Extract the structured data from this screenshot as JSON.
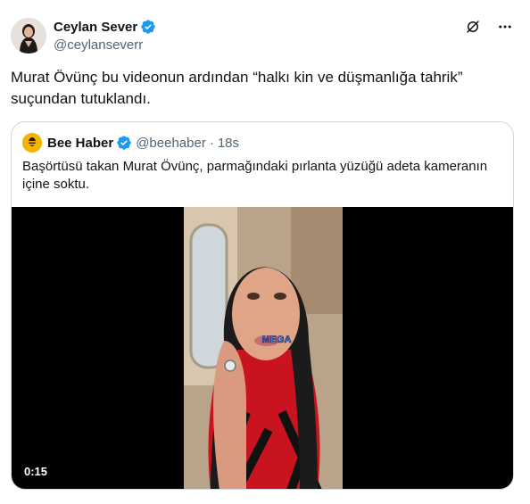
{
  "author": {
    "name": "Ceylan Sever",
    "handle": "@ceylanseverr",
    "avatar_icon": "user-avatar",
    "verified_color": "#1d9bf0"
  },
  "tweet": {
    "text": "Murat Övünç bu videonun ardından “halkı kin ve düşmanlığa tahrik” suçundan tutuklandı."
  },
  "icons": {
    "grok": "grok-icon",
    "more": "more-icon"
  },
  "quote": {
    "name": "Bee Haber",
    "handle": "@beehaber",
    "separator": "·",
    "time": "18s",
    "text": "Başörtüsü takan Murat Övünç, parmağındaki pırlanta yüzüğü adeta kameranın içine soktu.",
    "avatar_color": "#f5b400"
  },
  "video": {
    "duration": "0:15",
    "watermark": "MEGA"
  }
}
